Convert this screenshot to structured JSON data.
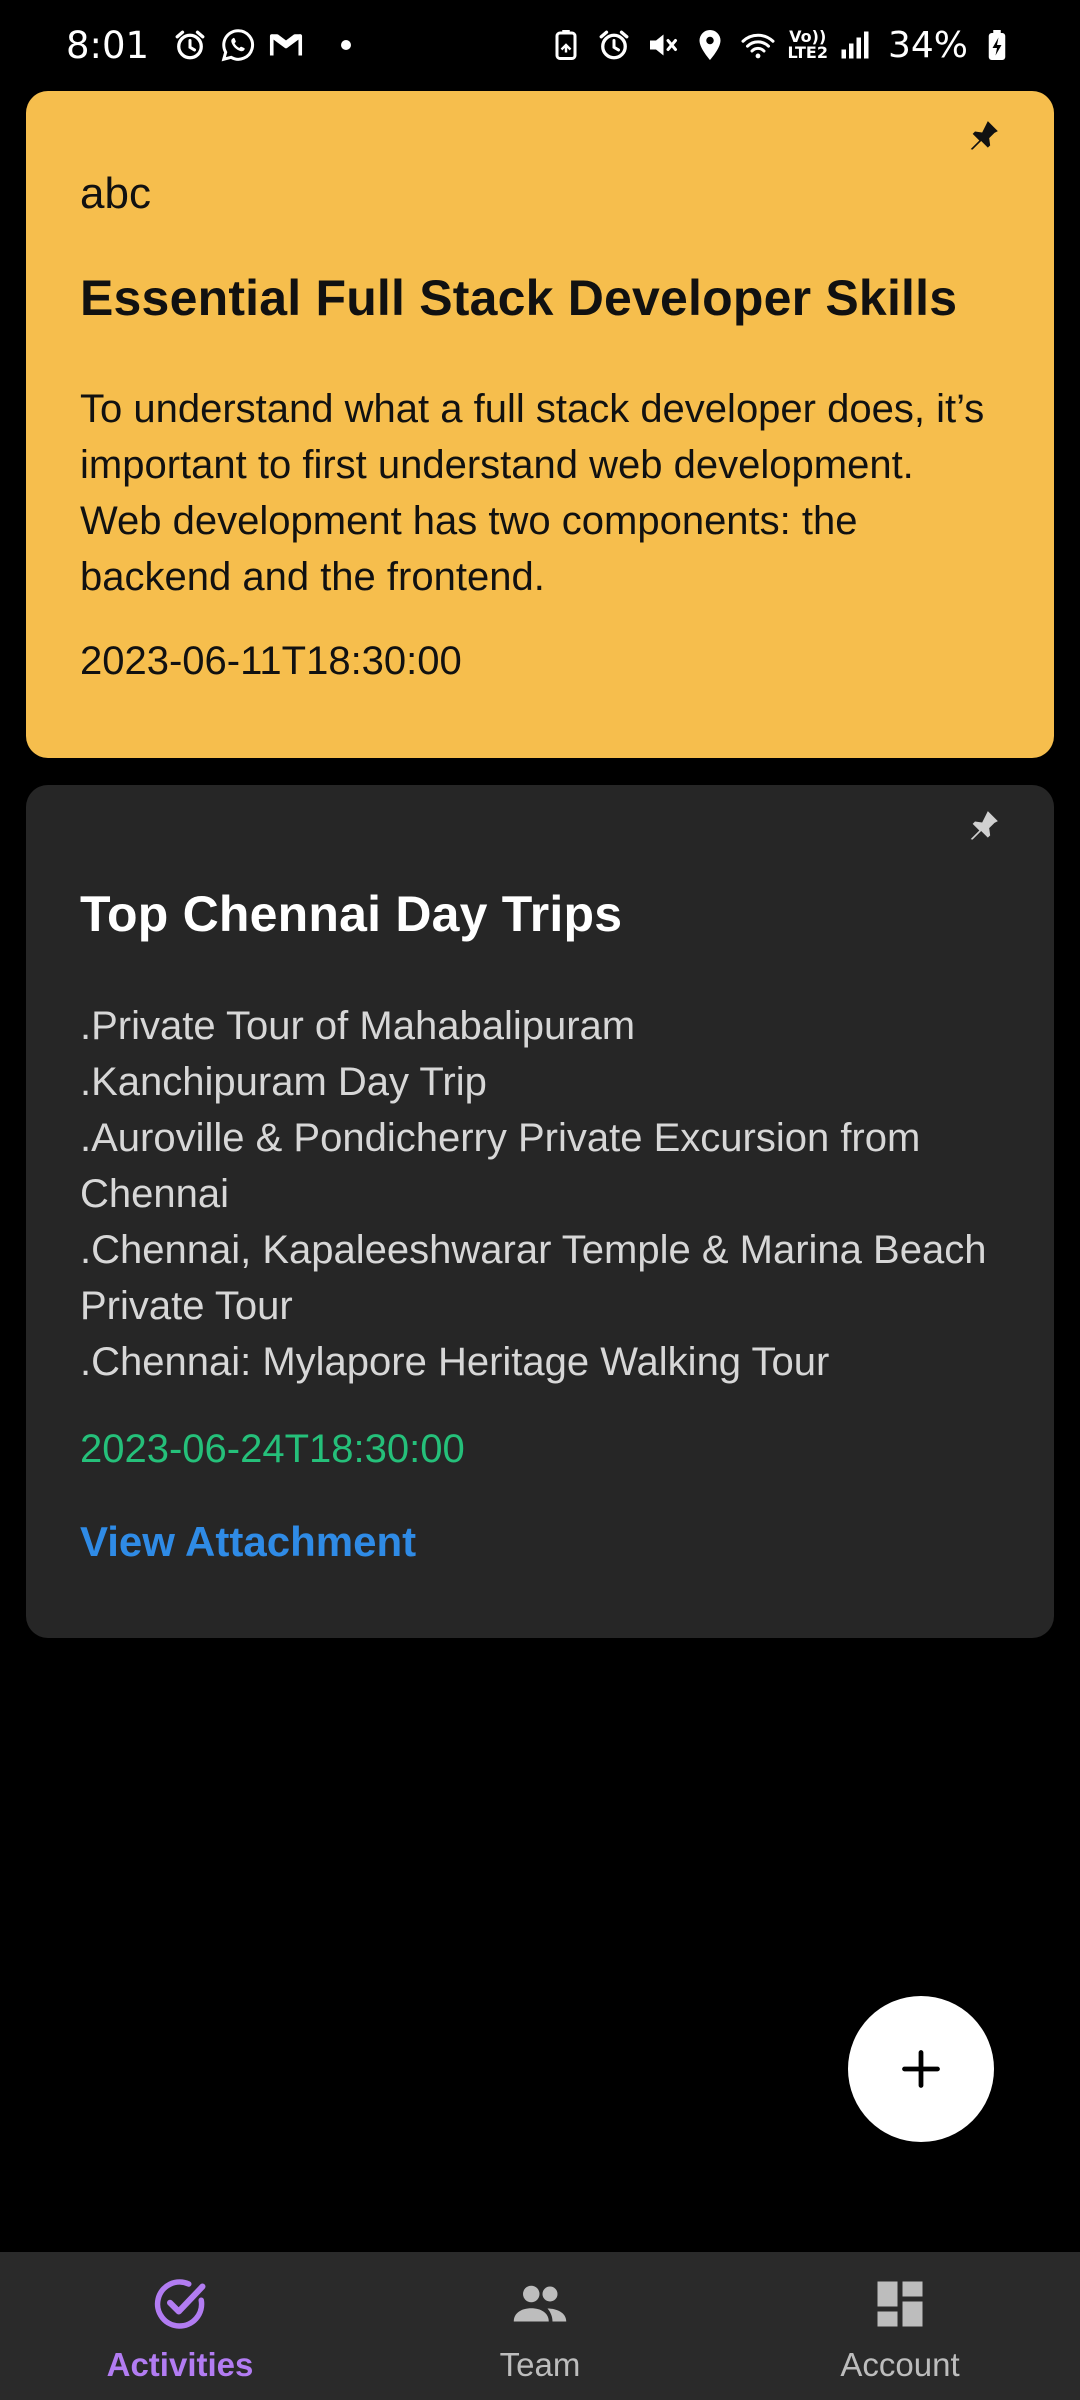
{
  "status_bar": {
    "time": "8:01",
    "network": {
      "top": "Vo))",
      "bottom": "LTE2"
    },
    "battery": "34%"
  },
  "notes": [
    {
      "label": "abc",
      "title": "Essential Full Stack Developer Skills",
      "body": "To understand what a full stack developer does, it’s important to first understand web development. Web development has two components: the backend and the frontend.",
      "date": "2023-06-11T18:30:00",
      "color": "#F6BE4D",
      "pinned_icon": "pin-icon"
    },
    {
      "title": "Top Chennai Day Trips",
      "body_lines": [
        ".Private Tour of Mahabalipuram",
        ".Kanchipuram Day Trip",
        ".Auroville & Pondicherry Private Excursion from Chennai",
        ".Chennai, Kapaleeshwarar Temple & Marina Beach Private Tour",
        ".Chennai: Mylapore Heritage Walking Tour"
      ],
      "date": "2023-06-24T18:30:00",
      "date_color": "#25C07A",
      "link": "View Attachment",
      "color": "#262626",
      "pinned_icon": "pin-icon"
    }
  ],
  "fab": {
    "icon": "plus-icon"
  },
  "bottom_nav": {
    "items": [
      {
        "label": "Activities",
        "icon": "check-circle-icon",
        "active": true
      },
      {
        "label": "Team",
        "icon": "people-icon",
        "active": false
      },
      {
        "label": "Account",
        "icon": "dashboard-icon",
        "active": false
      }
    ],
    "active_color": "#B27CF2"
  }
}
